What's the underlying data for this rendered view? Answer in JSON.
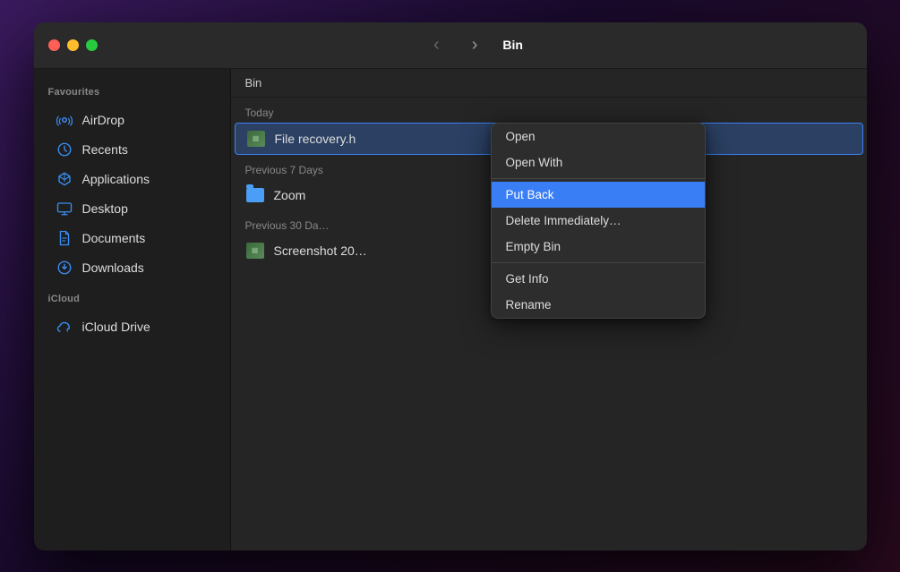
{
  "window": {
    "title": "Bin",
    "traffic_lights": {
      "close_label": "close",
      "minimize_label": "minimize",
      "maximize_label": "maximize"
    },
    "nav_back": "‹",
    "nav_forward": "›"
  },
  "sidebar": {
    "favourites_label": "Favourites",
    "icloud_label": "iCloud",
    "items_favourites": [
      {
        "id": "airdrop",
        "label": "AirDrop",
        "icon": "airdrop"
      },
      {
        "id": "recents",
        "label": "Recents",
        "icon": "recents"
      },
      {
        "id": "applications",
        "label": "Applications",
        "icon": "applications"
      },
      {
        "id": "desktop",
        "label": "Desktop",
        "icon": "desktop"
      },
      {
        "id": "documents",
        "label": "Documents",
        "icon": "documents"
      },
      {
        "id": "downloads",
        "label": "Downloads",
        "icon": "downloads"
      }
    ],
    "items_icloud": [
      {
        "id": "icloud-drive",
        "label": "iCloud Drive",
        "icon": "icloud"
      }
    ]
  },
  "filepane": {
    "breadcrumb": "Bin",
    "sections": [
      {
        "id": "today",
        "label": "Today",
        "items": [
          {
            "id": "file-recovery",
            "name": "File recovery.h",
            "type": "image",
            "selected": true
          }
        ]
      },
      {
        "id": "previous-7",
        "label": "Previous 7 Days",
        "items": [
          {
            "id": "zoom",
            "name": "Zoom",
            "type": "folder",
            "selected": false
          }
        ]
      },
      {
        "id": "previous-30",
        "label": "Previous 30 Da…",
        "items": [
          {
            "id": "screenshot",
            "name": "Screenshot 20…",
            "type": "image",
            "selected": false
          }
        ]
      }
    ]
  },
  "context_menu": {
    "items": [
      {
        "id": "open",
        "label": "Open",
        "highlighted": false,
        "separator_after": false
      },
      {
        "id": "open-with",
        "label": "Open With",
        "highlighted": false,
        "separator_after": true
      },
      {
        "id": "put-back",
        "label": "Put Back",
        "highlighted": true,
        "separator_after": false
      },
      {
        "id": "delete-immediately",
        "label": "Delete Immediately…",
        "highlighted": false,
        "separator_after": false
      },
      {
        "id": "empty-bin",
        "label": "Empty Bin",
        "highlighted": false,
        "separator_after": true
      },
      {
        "id": "get-info",
        "label": "Get Info",
        "highlighted": false,
        "separator_after": false
      },
      {
        "id": "rename",
        "label": "Rename",
        "highlighted": false,
        "separator_after": false
      }
    ]
  }
}
